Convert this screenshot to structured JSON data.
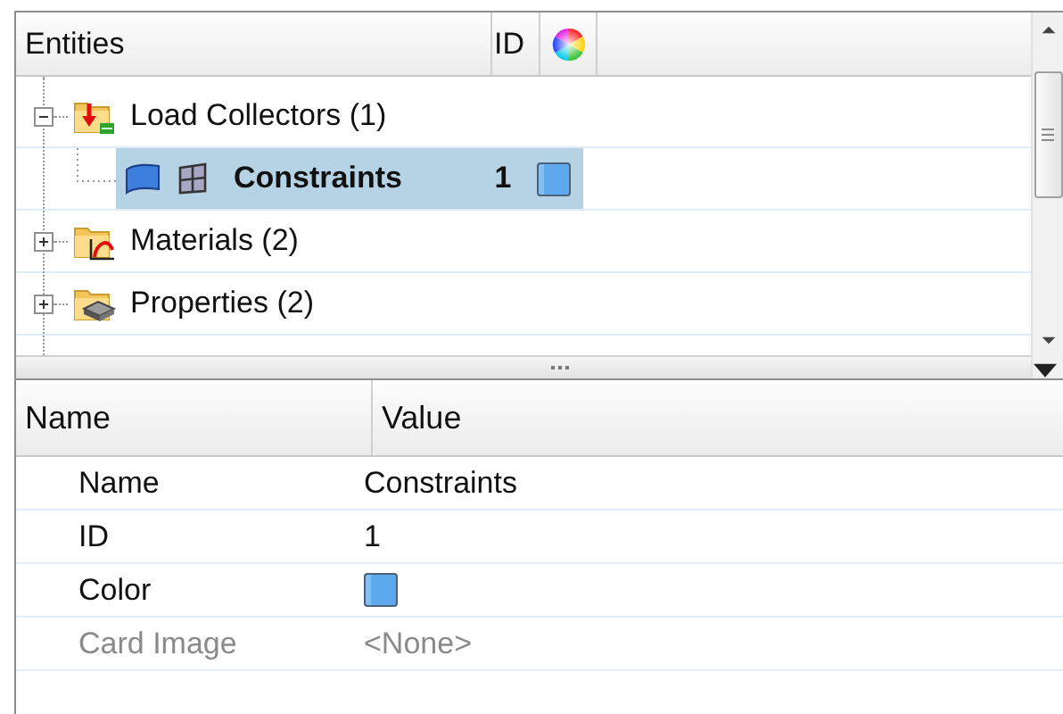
{
  "entity_tree": {
    "columns": [
      "Entities",
      "ID"
    ],
    "items": [
      {
        "label": "Load Collectors (1)",
        "kind": "load_collector",
        "expanded": true,
        "selected": false,
        "children": [
          {
            "label": "Constraints",
            "kind": "entity",
            "id": "1",
            "color": "#5ea8ee",
            "selected": true
          }
        ]
      },
      {
        "label": "Materials (2)",
        "kind": "material",
        "expanded": false,
        "selected": false
      },
      {
        "label": "Properties (2)",
        "kind": "property",
        "expanded": false,
        "selected": false
      }
    ]
  },
  "properties": {
    "columns": [
      "Name",
      "Value"
    ],
    "rows": [
      {
        "name": "Name",
        "kind": "text",
        "value": "Constraints",
        "disabled": false
      },
      {
        "name": "ID",
        "kind": "text",
        "value": "1",
        "disabled": false
      },
      {
        "name": "Color",
        "kind": "color",
        "color": "#5ea8ee",
        "disabled": false
      },
      {
        "name": "Card Image",
        "kind": "text",
        "value": "<None>",
        "disabled": true
      }
    ]
  }
}
